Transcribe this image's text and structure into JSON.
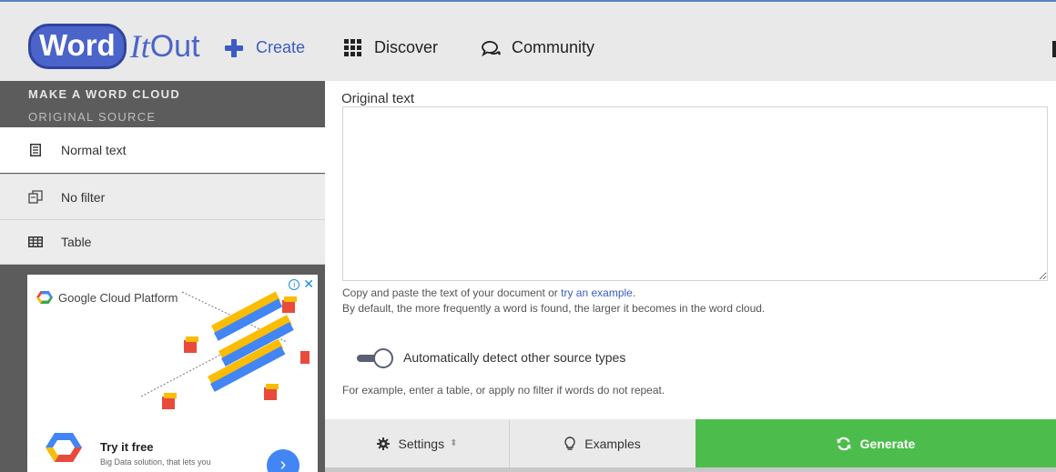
{
  "header": {
    "logo_word": "Word",
    "logo_it": "It",
    "logo_out": "Out",
    "nav": {
      "create": "Create",
      "discover": "Discover",
      "community": "Community"
    }
  },
  "sidebar": {
    "heading": "MAKE A WORD CLOUD",
    "subheading": "ORIGINAL SOURCE",
    "items": [
      {
        "label": "Normal text",
        "icon": "document-icon",
        "active": true
      },
      {
        "label": "No filter",
        "icon": "copy-icon",
        "active": false
      },
      {
        "label": "Table",
        "icon": "table-icon",
        "active": false
      }
    ]
  },
  "ad": {
    "brand": "Google Cloud Platform",
    "title": "Try it free",
    "subtitle": "Big Data solution, that lets you"
  },
  "main": {
    "label": "Original text",
    "textarea_value": "",
    "help_prefix": "Copy and paste the text of your document or ",
    "help_link": "try an example",
    "help_suffix": ".",
    "help_line2": "By default, the more frequently a word is found, the larger it becomes in the word cloud.",
    "toggle_label": "Automatically detect other source types",
    "toggle_on": true,
    "help_line3": "For example, enter a table, or apply no filter if words do not repeat."
  },
  "bottom": {
    "settings": "Settings",
    "examples": "Examples",
    "generate": "Generate"
  },
  "colors": {
    "brand_blue": "#4a64c9",
    "generate_green": "#4cbd4d",
    "sidebar_dark": "#5c5c5c"
  }
}
